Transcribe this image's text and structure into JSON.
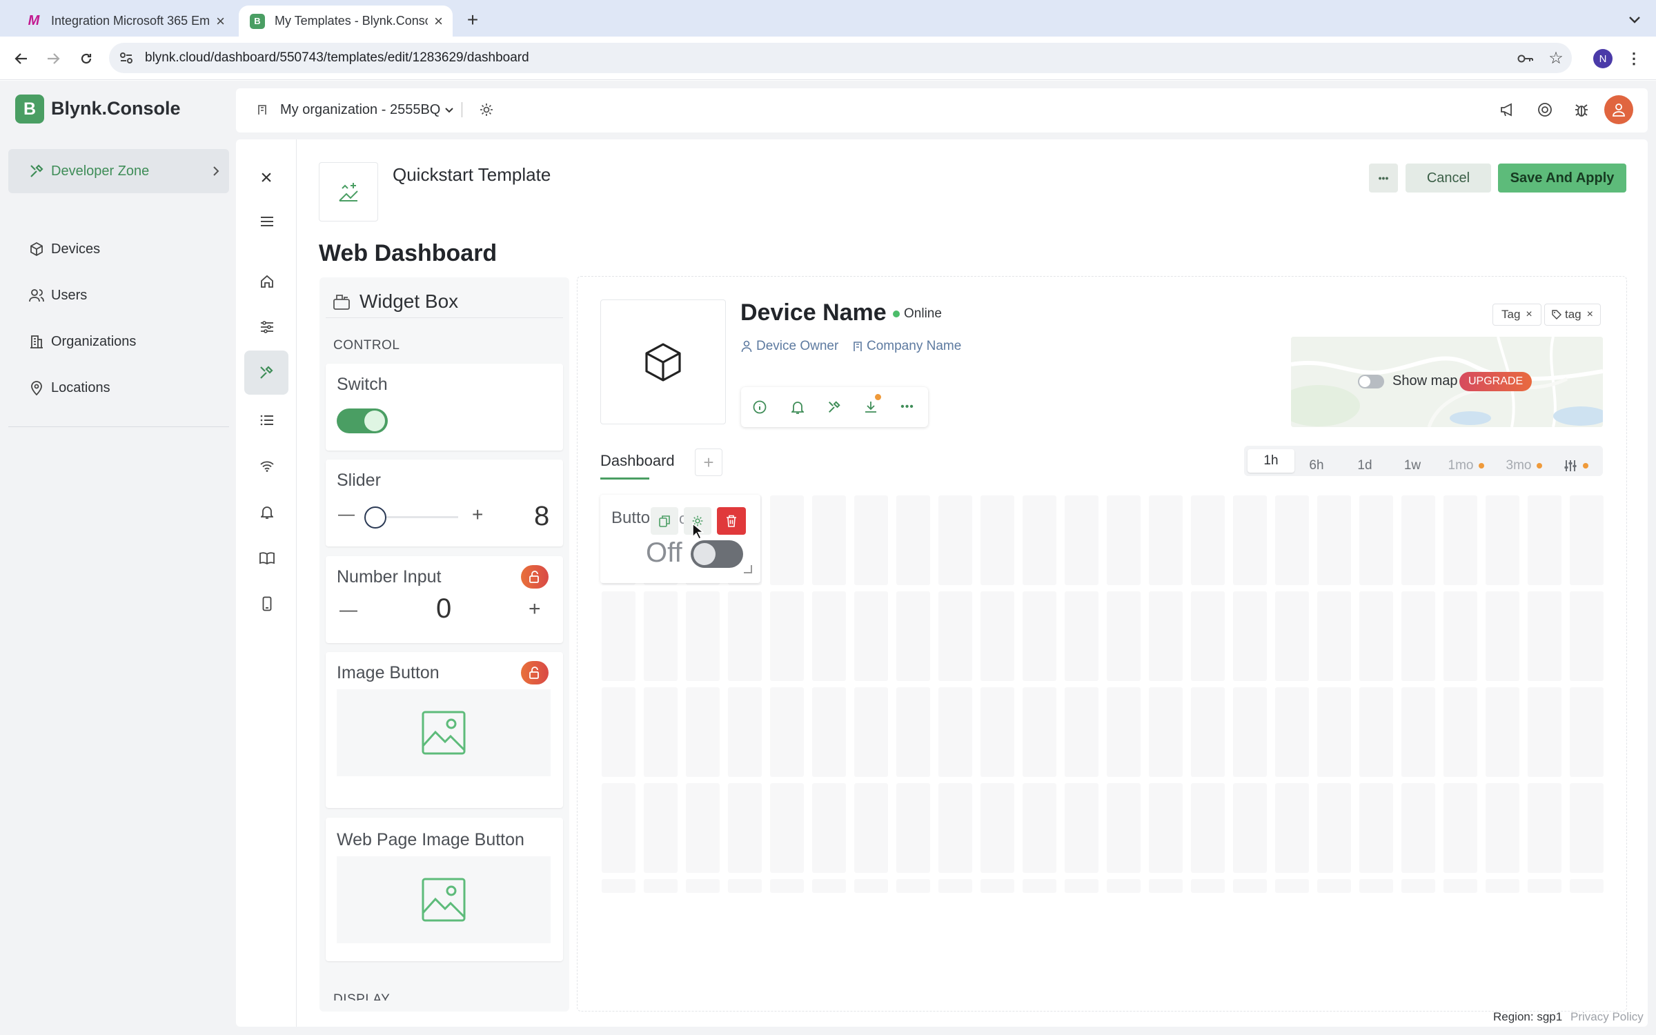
{
  "browser": {
    "tabs": [
      {
        "title": "Integration Microsoft 365 Em",
        "favicon": "M"
      },
      {
        "title": "My Templates - Blynk.Consol",
        "favicon": "B"
      }
    ],
    "url": "blynk.cloud/dashboard/550743/templates/edit/1283629/dashboard",
    "profile_initial": "N"
  },
  "header": {
    "brand": "Blynk.Console",
    "brand_letter": "B",
    "org": "My organization - 2555BQ"
  },
  "sidebar": {
    "developer_zone": "Developer Zone",
    "items": [
      {
        "label": "Devices",
        "icon": "cube-icon"
      },
      {
        "label": "Users",
        "icon": "users-icon"
      },
      {
        "label": "Organizations",
        "icon": "building-icon"
      },
      {
        "label": "Locations",
        "icon": "location-pin-icon"
      }
    ]
  },
  "template": {
    "name": "Quickstart Template",
    "more": "•••",
    "cancel": "Cancel",
    "save": "Save And Apply"
  },
  "page_title": "Web Dashboard",
  "widget_box": {
    "title": "Widget Box",
    "section_control": "CONTROL",
    "switch": {
      "title": "Switch",
      "on": true
    },
    "slider": {
      "title": "Slider",
      "minus": "—",
      "plus": "+",
      "value": "8"
    },
    "number_input": {
      "title": "Number Input",
      "minus": "—",
      "plus": "+",
      "value": "0"
    },
    "image_button": {
      "title": "Image Button"
    },
    "web_image_button": {
      "title": "Web Page Image Button"
    },
    "section_display": "DISPLAY"
  },
  "device": {
    "name": "Device Name",
    "status": "Online",
    "owner": "Device Owner",
    "company": "Company Name",
    "tags": [
      "Tag",
      "tag"
    ],
    "show_map": "Show map",
    "upgrade": "UPGRADE"
  },
  "dashboard": {
    "tab": "Dashboard",
    "add": "+",
    "timeframes": [
      {
        "label": "1h",
        "active": true,
        "premium": false
      },
      {
        "label": "6h",
        "active": false,
        "premium": false
      },
      {
        "label": "1d",
        "active": false,
        "premium": false
      },
      {
        "label": "1w",
        "active": false,
        "premium": false
      },
      {
        "label": "1mo",
        "active": false,
        "premium": true
      },
      {
        "label": "3mo",
        "active": false,
        "premium": true
      }
    ]
  },
  "widget": {
    "title": "Butto",
    "title_trailing": "ol...",
    "state": "Off"
  },
  "footer": {
    "region": "Region: sgp1",
    "privacy": "Privacy Policy"
  },
  "colors": {
    "brand_green": "#4a9e63",
    "save_green": "#5dbb7a",
    "danger_red": "#e0393b",
    "status_online": "#4cbd6a"
  }
}
